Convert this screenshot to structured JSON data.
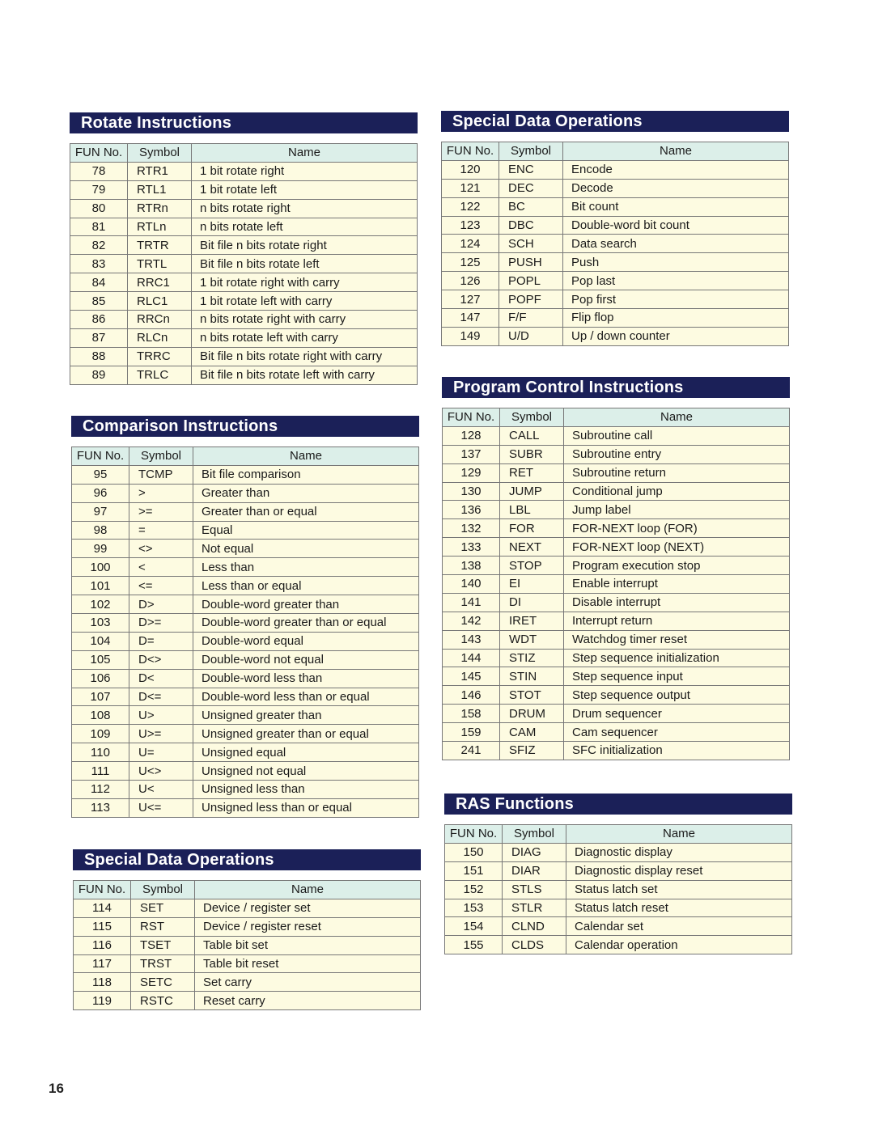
{
  "page_number": "16",
  "columns": {
    "fun": "FUN No.",
    "symbol": "Symbol",
    "name": "Name"
  },
  "sections": {
    "rotate": {
      "title": "Rotate Instructions",
      "rows": [
        {
          "fun": "78",
          "symbol": "RTR1",
          "name": "1 bit rotate right"
        },
        {
          "fun": "79",
          "symbol": "RTL1",
          "name": "1 bit rotate left"
        },
        {
          "fun": "80",
          "symbol": "RTRn",
          "name": "n bits rotate right"
        },
        {
          "fun": "81",
          "symbol": "RTLn",
          "name": "n bits rotate left"
        },
        {
          "fun": "82",
          "symbol": "TRTR",
          "name": "Bit file n bits rotate right"
        },
        {
          "fun": "83",
          "symbol": "TRTL",
          "name": "Bit file n bits rotate left"
        },
        {
          "fun": "84",
          "symbol": "RRC1",
          "name": "1 bit rotate right with carry"
        },
        {
          "fun": "85",
          "symbol": "RLC1",
          "name": "1 bit rotate left with carry"
        },
        {
          "fun": "86",
          "symbol": "RRCn",
          "name": "n bits rotate right with carry"
        },
        {
          "fun": "87",
          "symbol": "RLCn",
          "name": "n bits rotate left with carry"
        },
        {
          "fun": "88",
          "symbol": "TRRC",
          "name": "Bit file n bits rotate right with carry"
        },
        {
          "fun": "89",
          "symbol": "TRLC",
          "name": "Bit file n bits rotate left with carry"
        }
      ]
    },
    "comparison": {
      "title": "Comparison Instructions",
      "rows": [
        {
          "fun": "95",
          "symbol": "TCMP",
          "name": "Bit file comparison"
        },
        {
          "fun": "96",
          "symbol": ">",
          "name": "Greater than"
        },
        {
          "fun": "97",
          "symbol": ">=",
          "name": "Greater than or equal"
        },
        {
          "fun": "98",
          "symbol": "=",
          "name": "Equal"
        },
        {
          "fun": "99",
          "symbol": "<>",
          "name": "Not equal"
        },
        {
          "fun": "100",
          "symbol": "<",
          "name": "Less than"
        },
        {
          "fun": "101",
          "symbol": "<=",
          "name": "Less than or equal"
        },
        {
          "fun": "102",
          "symbol": "D>",
          "name": "Double-word greater than"
        },
        {
          "fun": "103",
          "symbol": "D>=",
          "name": "Double-word greater than or equal"
        },
        {
          "fun": "104",
          "symbol": "D=",
          "name": "Double-word equal"
        },
        {
          "fun": "105",
          "symbol": "D<>",
          "name": "Double-word not equal"
        },
        {
          "fun": "106",
          "symbol": "D<",
          "name": "Double-word less than"
        },
        {
          "fun": "107",
          "symbol": "D<=",
          "name": "Double-word less than or equal"
        },
        {
          "fun": "108",
          "symbol": "U>",
          "name": "Unsigned greater than"
        },
        {
          "fun": "109",
          "symbol": "U>=",
          "name": "Unsigned greater than or equal"
        },
        {
          "fun": "110",
          "symbol": "U=",
          "name": "Unsigned equal"
        },
        {
          "fun": "111",
          "symbol": "U<>",
          "name": "Unsigned not equal"
        },
        {
          "fun": "112",
          "symbol": "U<",
          "name": "Unsigned less than"
        },
        {
          "fun": "113",
          "symbol": "U<=",
          "name": "Unsigned less than or equal"
        }
      ]
    },
    "special_data_left": {
      "title": "Special Data Operations",
      "rows": [
        {
          "fun": "114",
          "symbol": "SET",
          "name": "Device / register set"
        },
        {
          "fun": "115",
          "symbol": "RST",
          "name": "Device / register reset"
        },
        {
          "fun": "116",
          "symbol": "TSET",
          "name": "Table bit set"
        },
        {
          "fun": "117",
          "symbol": "TRST",
          "name": "Table bit reset"
        },
        {
          "fun": "118",
          "symbol": "SETC",
          "name": "Set carry"
        },
        {
          "fun": "119",
          "symbol": "RSTC",
          "name": "Reset carry"
        }
      ]
    },
    "special_data_right": {
      "title": "Special Data Operations",
      "rows": [
        {
          "fun": "120",
          "symbol": "ENC",
          "name": "Encode"
        },
        {
          "fun": "121",
          "symbol": "DEC",
          "name": "Decode"
        },
        {
          "fun": "122",
          "symbol": "BC",
          "name": "Bit count"
        },
        {
          "fun": "123",
          "symbol": "DBC",
          "name": "Double-word bit count"
        },
        {
          "fun": "124",
          "symbol": "SCH",
          "name": "Data search"
        },
        {
          "fun": "125",
          "symbol": "PUSH",
          "name": "Push"
        },
        {
          "fun": "126",
          "symbol": "POPL",
          "name": "Pop last"
        },
        {
          "fun": "127",
          "symbol": "POPF",
          "name": "Pop first"
        },
        {
          "fun": "147",
          "symbol": "F/F",
          "name": "Flip flop"
        },
        {
          "fun": "149",
          "symbol": "U/D",
          "name": "Up / down counter"
        }
      ]
    },
    "program_control": {
      "title": "Program Control Instructions",
      "rows": [
        {
          "fun": "128",
          "symbol": "CALL",
          "name": "Subroutine call"
        },
        {
          "fun": "137",
          "symbol": "SUBR",
          "name": "Subroutine entry"
        },
        {
          "fun": "129",
          "symbol": "RET",
          "name": "Subroutine return"
        },
        {
          "fun": "130",
          "symbol": "JUMP",
          "name": "Conditional jump"
        },
        {
          "fun": "136",
          "symbol": "LBL",
          "name": "Jump label"
        },
        {
          "fun": "132",
          "symbol": "FOR",
          "name": "FOR-NEXT loop (FOR)"
        },
        {
          "fun": "133",
          "symbol": "NEXT",
          "name": "FOR-NEXT loop (NEXT)"
        },
        {
          "fun": "138",
          "symbol": "STOP",
          "name": "Program execution stop"
        },
        {
          "fun": "140",
          "symbol": "EI",
          "name": "Enable interrupt"
        },
        {
          "fun": "141",
          "symbol": "DI",
          "name": "Disable interrupt"
        },
        {
          "fun": "142",
          "symbol": "IRET",
          "name": "Interrupt return"
        },
        {
          "fun": "143",
          "symbol": "WDT",
          "name": "Watchdog timer reset"
        },
        {
          "fun": "144",
          "symbol": "STIZ",
          "name": "Step sequence initialization"
        },
        {
          "fun": "145",
          "symbol": "STIN",
          "name": "Step sequence input"
        },
        {
          "fun": "146",
          "symbol": "STOT",
          "name": "Step sequence output"
        },
        {
          "fun": "158",
          "symbol": "DRUM",
          "name": "Drum sequencer"
        },
        {
          "fun": "159",
          "symbol": "CAM",
          "name": "Cam sequencer"
        },
        {
          "fun": "241",
          "symbol": "SFIZ",
          "name": "SFC initialization"
        }
      ]
    },
    "ras": {
      "title": "RAS Functions",
      "rows": [
        {
          "fun": "150",
          "symbol": "DIAG",
          "name": "Diagnostic display"
        },
        {
          "fun": "151",
          "symbol": "DIAR",
          "name": "Diagnostic display reset"
        },
        {
          "fun": "152",
          "symbol": "STLS",
          "name": "Status latch set"
        },
        {
          "fun": "153",
          "symbol": "STLR",
          "name": "Status latch reset"
        },
        {
          "fun": "154",
          "symbol": "CLND",
          "name": "Calendar set"
        },
        {
          "fun": "155",
          "symbol": "CLDS",
          "name": "Calendar operation"
        }
      ]
    }
  }
}
